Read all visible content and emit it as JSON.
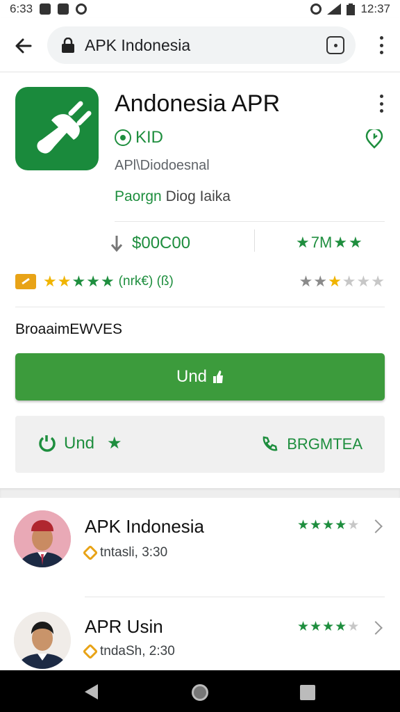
{
  "status_bar": {
    "time": "6:33",
    "clock": "12:37"
  },
  "browser": {
    "url": "APK Indonesia"
  },
  "app": {
    "title": "Andonesia APR",
    "developer": "KID",
    "subtitle": "APl\\Diodoesnal",
    "category_left": "Paorgn",
    "category_right": "Diog Iaika",
    "downloads": "$00C00",
    "rating_label": "7M",
    "review_count": "(nrk€) (ß)",
    "promo_heading": "BroaaimEWVES",
    "install_label": "Und",
    "secondary_left": "Und",
    "secondary_right": "BRGMTEA"
  },
  "colors": {
    "green": "#1e8e3e",
    "install_green": "#3c9b3c",
    "gold": "#f0b400",
    "icon_bg": "#1a8a3c"
  },
  "list": [
    {
      "name": "APK Indonesia",
      "meta": "tntasli, 3:30",
      "rating": 3.5
    },
    {
      "name": "APR Usin",
      "meta": "tndaSh, 2:30",
      "rating": 3.5
    }
  ]
}
